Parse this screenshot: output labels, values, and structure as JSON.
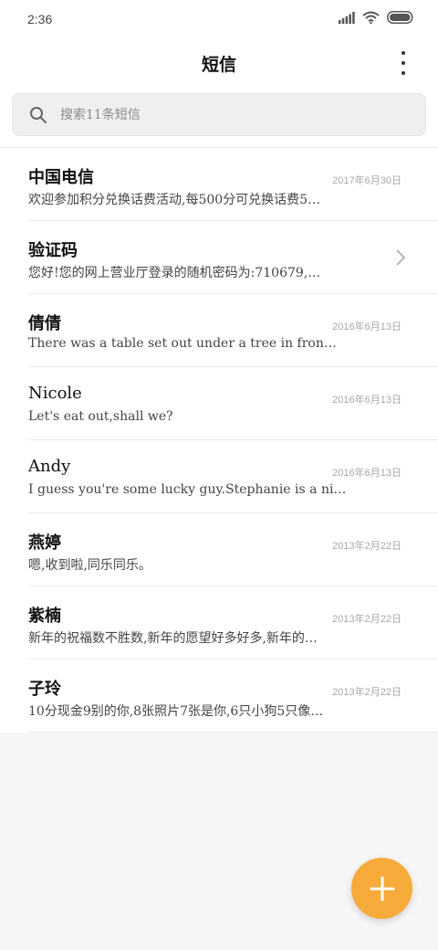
{
  "status_bar": {
    "time": "2:36"
  },
  "header": {
    "title": "短信"
  },
  "search": {
    "placeholder": "搜索11条短信"
  },
  "conversations": [
    {
      "name": "中国电信",
      "date": "2017年6月30日",
      "preview": "欢迎参加积分兑换话费活动,每500分可兑换话费5…",
      "chevron": false
    },
    {
      "name": "验证码",
      "date": "",
      "preview": "您好!您的网上营业厅登录的随机密码为:710679,…",
      "chevron": true
    },
    {
      "name": "倩倩",
      "date": "2016年6月13日",
      "preview": "There was a table set out under a tree in fron…",
      "chevron": false
    },
    {
      "name": "Nicole",
      "date": "2016年6月13日",
      "preview": "Let's eat out,shall we?",
      "chevron": false
    },
    {
      "name": "Andy",
      "date": "2016年6月13日",
      "preview": "I guess you're some lucky guy.Stephanie is a ni…",
      "chevron": false
    },
    {
      "name": "燕婷",
      "date": "2013年2月22日",
      "preview": "嗯,收到啦,同乐同乐。",
      "chevron": false
    },
    {
      "name": "紫楠",
      "date": "2013年2月22日",
      "preview": "新年的祝福数不胜数,新年的愿望好多好多,新年的…",
      "chevron": false
    },
    {
      "name": "子玲",
      "date": "2013年2月22日",
      "preview": "10分现金9别的你,8张照片7张是你,6只小狗5只像…",
      "chevron": false
    }
  ],
  "colors": {
    "accent": "#f6ab3b",
    "background": "#f6f6f6",
    "divider": "#ececec"
  },
  "icons": {
    "search": "search-icon",
    "more": "more-vertical-icon",
    "add": "plus-icon",
    "chevron": "chevron-right-icon"
  }
}
